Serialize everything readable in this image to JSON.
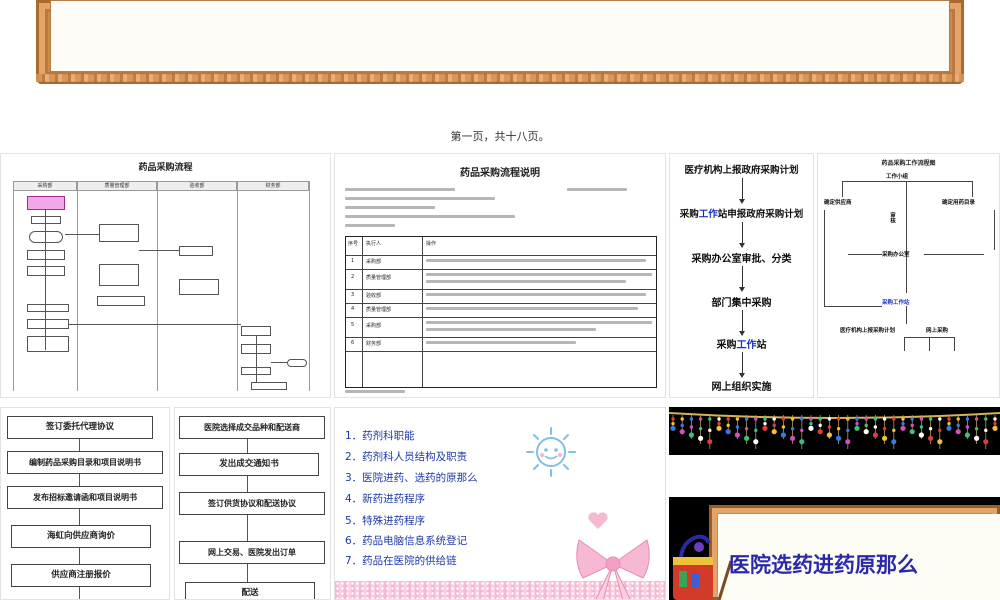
{
  "page_caption": "第一页，共十八页。",
  "thumb1": {
    "title": "药品采购流程",
    "lanes": [
      "采购部",
      "质量管理部",
      "验收部",
      "财务部"
    ]
  },
  "thumb2": {
    "title": "药品采购流程说明",
    "table_header": [
      "序号",
      "执行人",
      "操作"
    ],
    "rows": [
      {
        "no": "1",
        "who": "采购部"
      },
      {
        "no": "2",
        "who": "质量管理部"
      },
      {
        "no": "3",
        "who": "验收部"
      },
      {
        "no": "4",
        "who": "质量管理部"
      },
      {
        "no": "5",
        "who": "采购部"
      },
      {
        "no": "6",
        "who": "财务部"
      }
    ]
  },
  "thumb3": {
    "steps": [
      {
        "pre": "医疗机构上报政府采购计划",
        "blue": "",
        "post": ""
      },
      {
        "pre": "采购",
        "blue": "工作",
        "post": "站申报政府采购计划"
      },
      {
        "pre": "采购办公室审批、分类",
        "blue": "",
        "post": ""
      },
      {
        "pre": "部门集中采购",
        "blue": "",
        "post": ""
      },
      {
        "pre": "采购",
        "blue": "工作",
        "post": "站"
      },
      {
        "pre": "网上组织实施",
        "blue": "",
        "post": ""
      }
    ]
  },
  "thumb4": {
    "title": "药品采购工作流程图",
    "labels": {
      "group": "工作小组",
      "supplier": "确定供应商",
      "catalog": "确定用药目录",
      "review": "审核",
      "office": "采购办公室",
      "station": "采购工作站",
      "plan": "医疗机构上报采购计划",
      "online": "网上采购"
    }
  },
  "thumb5": {
    "steps": [
      "签订委托代理协议",
      "编制药品采购目录和项目说明书",
      "发布招标邀请函和项目说明书",
      "海虹向供应商询价",
      "供应商注册报价"
    ]
  },
  "thumb6": {
    "steps": [
      "医院选择成交品种和配送商",
      "发出成交通知书",
      "签订供货协议和配送协议",
      "网上交易、医院发出订单",
      "配送"
    ]
  },
  "thumb7": {
    "items": [
      "1．药剂科职能",
      "2．药剂科人员结构及职责",
      "3．医院进药、选药的原那么",
      "4．新药进药程序",
      "5．特殊进药程序",
      "6．药品电脑信息系统登记",
      "7．药品在医院的供给链"
    ]
  },
  "thumb9": {
    "title": "医院选药进药原那么"
  },
  "colors": {
    "list_blue": "#1d3aa8",
    "accent_blue": "#1a32c8",
    "wood": "#c98a4b",
    "ribbon_pink": "#f6b9d3"
  }
}
